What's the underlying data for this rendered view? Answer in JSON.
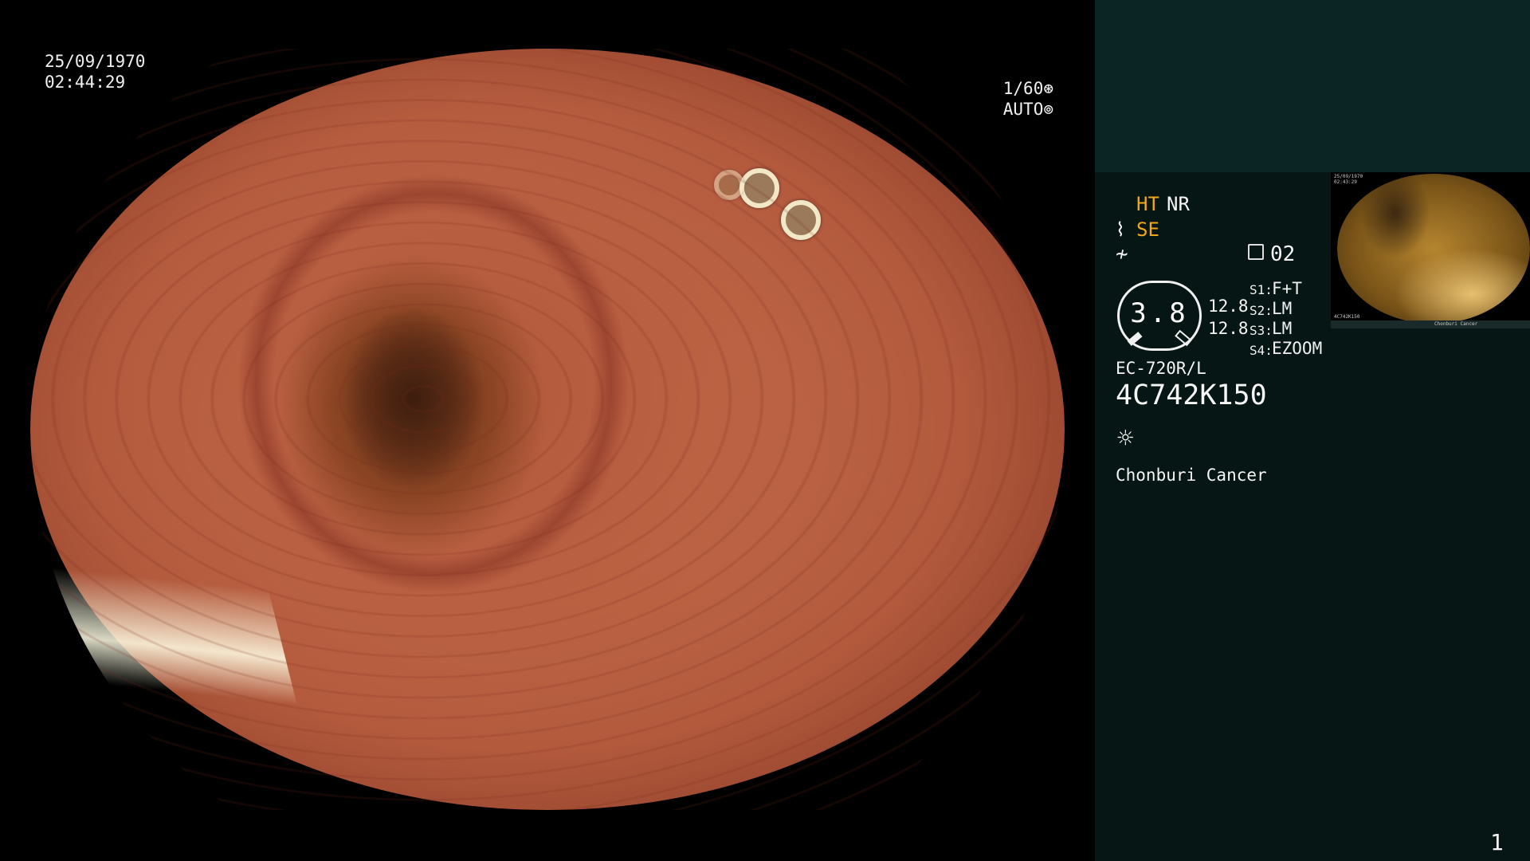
{
  "overlay": {
    "date": "25/09/1970",
    "time": "02:44:29",
    "shutter": "1/60",
    "exposure_mode": "AUTO"
  },
  "panel": {
    "mode_ht": "HT",
    "mode_nr": "NR",
    "mode_se": "SE",
    "scope_glyph": "⌇",
    "freeze_glyph": "≁",
    "record_count": "02",
    "gauge_value": "3.8",
    "pressure_top": "12.8",
    "pressure_bottom": "12.8",
    "switches": [
      {
        "label": "S1:",
        "value": "F+T"
      },
      {
        "label": "S2:",
        "value": "LM"
      },
      {
        "label": "S3:",
        "value": "LM"
      },
      {
        "label": "S4:",
        "value": "EZOOM"
      }
    ],
    "scope_model": "EC-720R/L",
    "scope_serial": "4C742K150",
    "light_icon": "☼",
    "institution": "Chonburi Cancer",
    "page_number": "1"
  },
  "thumbnail": {
    "date": "25/09/1970",
    "time": "02:43:29",
    "serial": "4C742K150",
    "institution": "Chonburi Cancer"
  },
  "colors": {
    "accent_amber": "#f2a71a",
    "panel_bg": "#061614",
    "panel_top_bg": "#0b2424"
  }
}
